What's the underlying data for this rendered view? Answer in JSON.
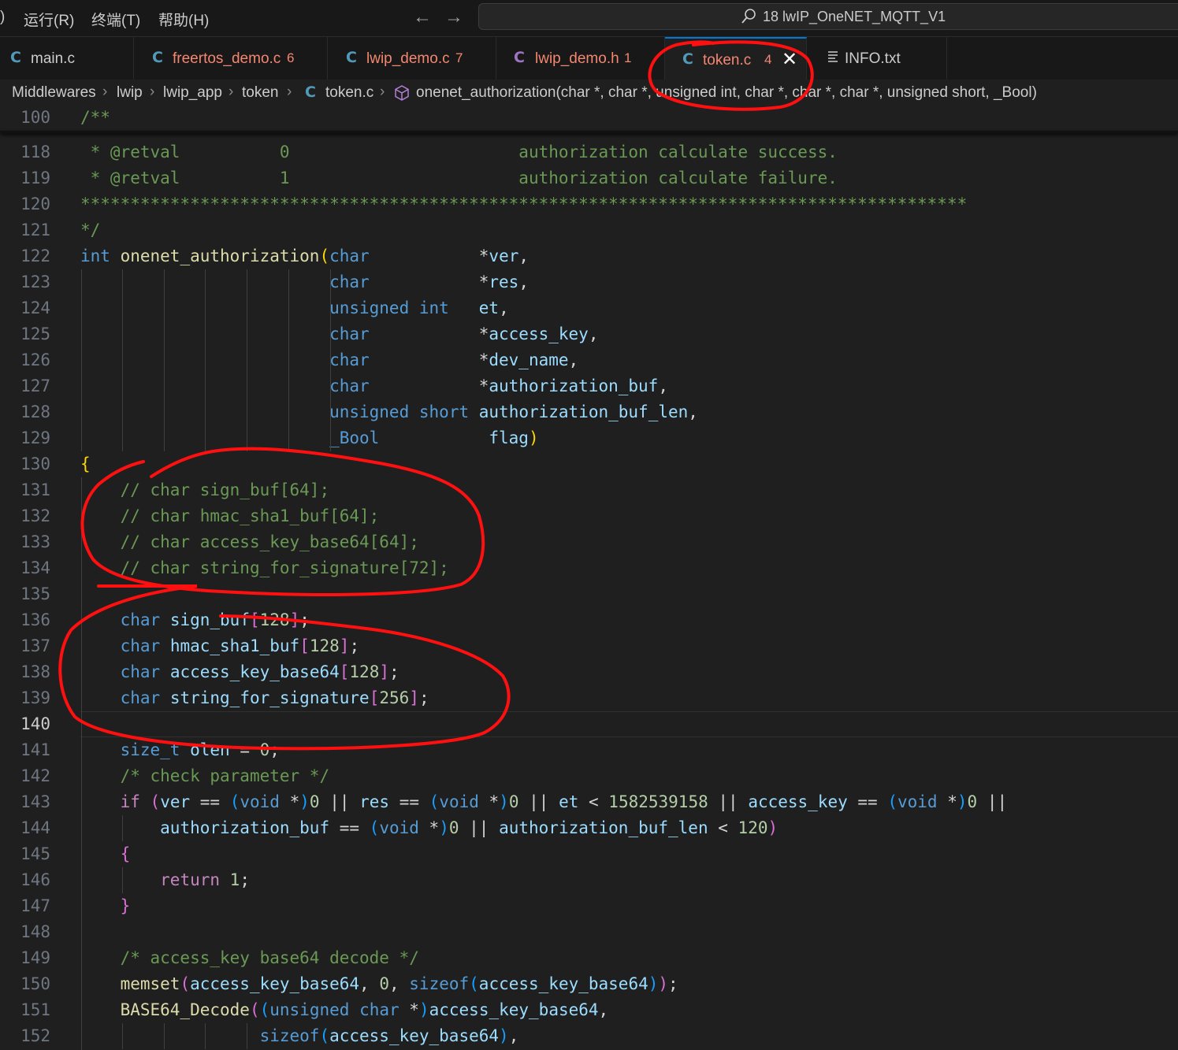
{
  "menubar": {
    "fragment": ")",
    "items": [
      "运行(R)",
      "终端(T)",
      "帮助(H)"
    ],
    "search_text": "18 lwIP_OneNET_MQTT_V1"
  },
  "tabs": [
    {
      "icon": "C",
      "icon_color": "#519aba",
      "label": "main.c",
      "label_color": "#cccccc",
      "badge": ""
    },
    {
      "icon": "C",
      "icon_color": "#519aba",
      "label": "freertos_demo.c",
      "label_color": "#f48771",
      "badge": "6"
    },
    {
      "icon": "C",
      "icon_color": "#519aba",
      "label": "lwip_demo.c",
      "label_color": "#f48771",
      "badge": "7"
    },
    {
      "icon": "C",
      "icon_color": "#a074c4",
      "label": "lwip_demo.h",
      "label_color": "#f48771",
      "badge": "1"
    },
    {
      "icon": "C",
      "icon_color": "#519aba",
      "label": "token.c",
      "label_color": "#f48771",
      "badge": "4",
      "active": true
    },
    {
      "icon": "list-icon",
      "label": "INFO.txt",
      "label_color": "#cccccc",
      "badge": ""
    }
  ],
  "breadcrumb": {
    "parts": [
      "Middlewares",
      "lwip",
      "lwip_app",
      "token",
      "token.c"
    ],
    "symbol": "onenet_authorization(char *, char *, unsigned int, char *, char *, char *, unsigned short, _Bool)"
  },
  "editor": {
    "sticky_line": {
      "number": "100",
      "text": "/**"
    },
    "current_line": "140",
    "lines": [
      {
        "n": "118",
        "html": "<span class='cm'> * @retval          0                       authorization calculate success.</span>"
      },
      {
        "n": "119",
        "html": "<span class='cm'> * @retval          1                       authorization calculate failure.</span>"
      },
      {
        "n": "120",
        "html": "<span class='cm'>*****************************************************************************************</span>"
      },
      {
        "n": "121",
        "html": "<span class='cm'>*/</span>"
      },
      {
        "n": "122",
        "html": "<span class='ty'>int</span> <span class='fn'>onenet_authorization</span><span class='br1'>(</span><span class='ty'>char</span>           *<span class='va'>ver</span>,"
      },
      {
        "n": "123",
        "html": "                         <span class='ty'>char</span>           *<span class='va'>res</span>,"
      },
      {
        "n": "124",
        "html": "                         <span class='ty'>unsigned</span> <span class='ty'>int</span>   <span class='va'>et</span>,"
      },
      {
        "n": "125",
        "html": "                         <span class='ty'>char</span>           *<span class='va'>access_key</span>,"
      },
      {
        "n": "126",
        "html": "                         <span class='ty'>char</span>           *<span class='va'>dev_name</span>,"
      },
      {
        "n": "127",
        "html": "                         <span class='ty'>char</span>           *<span class='va'>authorization_buf</span>,"
      },
      {
        "n": "128",
        "html": "                         <span class='ty'>unsigned</span> <span class='ty'>short</span> <span class='va'>authorization_buf_len</span>,"
      },
      {
        "n": "129",
        "html": "                         <span class='ty'>_Bool</span>           <span class='va'>flag</span><span class='br1'>)</span>"
      },
      {
        "n": "130",
        "html": "<span class='br1'>{</span>"
      },
      {
        "n": "131",
        "html": "    <span class='cm'>// char sign_buf[64];</span>"
      },
      {
        "n": "132",
        "html": "    <span class='cm'>// char hmac_sha1_buf[64];</span>"
      },
      {
        "n": "133",
        "html": "    <span class='cm'>// char access_key_base64[64];</span>"
      },
      {
        "n": "134",
        "html": "    <span class='cm'>// char string_for_signature[72];</span>"
      },
      {
        "n": "135",
        "html": ""
      },
      {
        "n": "136",
        "html": "    <span class='ty'>char</span> <span class='va'>sign_buf</span><span class='br2'>[</span><span class='nu'>128</span><span class='br2'>]</span>;"
      },
      {
        "n": "137",
        "html": "    <span class='ty'>char</span> <span class='va'>hmac_sha1_buf</span><span class='br2'>[</span><span class='nu'>128</span><span class='br2'>]</span>;"
      },
      {
        "n": "138",
        "html": "    <span class='ty'>char</span> <span class='va'>access_key_base64</span><span class='br2'>[</span><span class='nu'>128</span><span class='br2'>]</span>;"
      },
      {
        "n": "139",
        "html": "    <span class='ty'>char</span> <span class='va'>string_for_signature</span><span class='br2'>[</span><span class='nu'>256</span><span class='br2'>]</span>;"
      },
      {
        "n": "140",
        "html": ""
      },
      {
        "n": "141",
        "html": "    <span class='ty'>size_t</span> <span class='va'>olen</span> = <span class='nu'>0</span>;"
      },
      {
        "n": "142",
        "html": "    <span class='cm'>/* check parameter */</span>"
      },
      {
        "n": "143",
        "html": "    <span class='ctl'>if</span> <span class='br2'>(</span><span class='va'>ver</span> == <span class='br3'>(</span><span class='ty'>void</span> *<span class='br3'>)</span><span class='nu'>0</span> || <span class='va'>res</span> == <span class='br3'>(</span><span class='ty'>void</span> *<span class='br3'>)</span><span class='nu'>0</span> || <span class='va'>et</span> &lt; <span class='nu'>1582539158</span> || <span class='va'>access_key</span> == <span class='br3'>(</span><span class='ty'>void</span> *<span class='br3'>)</span><span class='nu'>0</span> ||"
      },
      {
        "n": "144",
        "html": "        <span class='va'>authorization_buf</span> == <span class='br3'>(</span><span class='ty'>void</span> *<span class='br3'>)</span><span class='nu'>0</span> || <span class='va'>authorization_buf_len</span> &lt; <span class='nu'>120</span><span class='br2'>)</span>"
      },
      {
        "n": "145",
        "html": "    <span class='br2'>{</span>"
      },
      {
        "n": "146",
        "html": "        <span class='ctl'>return</span> <span class='nu'>1</span>;"
      },
      {
        "n": "147",
        "html": "    <span class='br2'>}</span>"
      },
      {
        "n": "148",
        "html": ""
      },
      {
        "n": "149",
        "html": "    <span class='cm'>/* access_key base64 decode */</span>"
      },
      {
        "n": "150",
        "html": "    <span class='fn'>memset</span><span class='br2'>(</span><span class='va'>access_key_base64</span>, <span class='nu'>0</span>, <span class='kw'>sizeof</span><span class='br3'>(</span><span class='va'>access_key_base64</span><span class='br3'>)</span><span class='br2'>)</span>;"
      },
      {
        "n": "151",
        "html": "    <span class='fn'>BASE64_Decode</span><span class='br2'>(</span><span class='br3'>(</span><span class='ty'>unsigned</span> <span class='ty'>char</span> *<span class='br3'>)</span><span class='va'>access_key_base64</span>,"
      },
      {
        "n": "152",
        "html": "                  <span class='kw'>sizeof</span><span class='br3'>(</span><span class='va'>access_key_base64</span><span class='br3'>)</span>,"
      }
    ]
  },
  "colors": {
    "annotation": "#ff0000",
    "active_tab_border": "#0078d4"
  }
}
